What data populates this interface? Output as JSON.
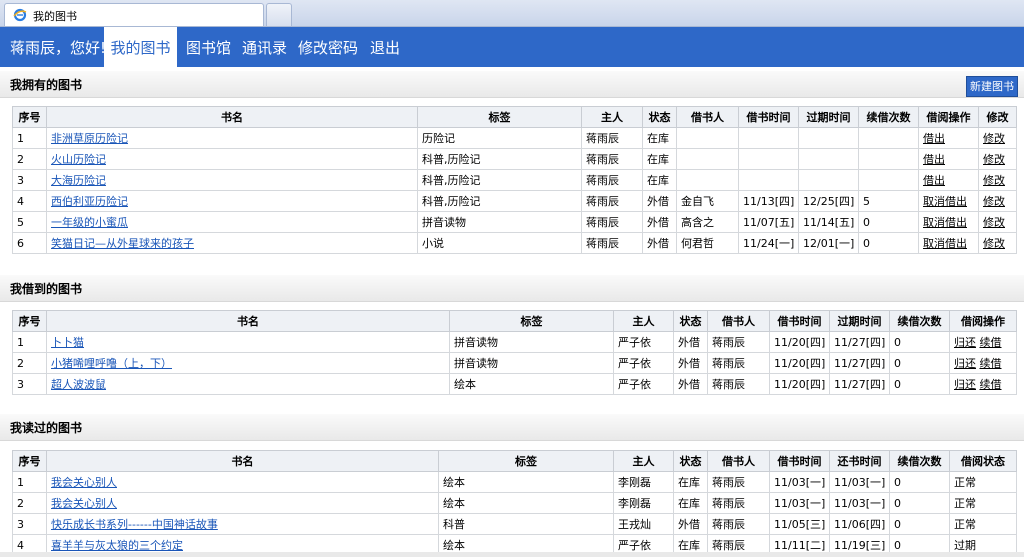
{
  "browser": {
    "tab_title": "我的图书"
  },
  "nav": {
    "greeting": "蒋雨辰，您好!",
    "items": [
      "我的图书",
      "图书馆",
      "通讯录",
      "修改密码",
      "退出"
    ]
  },
  "owned": {
    "title": "我拥有的图书",
    "new_button": "新建图书",
    "headers": [
      "序号",
      "书名",
      "标签",
      "主人",
      "状态",
      "借书人",
      "借书时间",
      "过期时间",
      "续借次数",
      "借阅操作",
      "修改"
    ],
    "rows": [
      {
        "no": "1",
        "name": "非洲草原历险记",
        "tag": "历险记",
        "owner": "蒋雨辰",
        "status": "在库",
        "borrower": "",
        "borrow_time": "",
        "due_time": "",
        "renew": "",
        "op": [
          "借出"
        ],
        "edit": "修改"
      },
      {
        "no": "2",
        "name": "火山历险记",
        "tag": "科普,历险记",
        "owner": "蒋雨辰",
        "status": "在库",
        "borrower": "",
        "borrow_time": "",
        "due_time": "",
        "renew": "",
        "op": [
          "借出"
        ],
        "edit": "修改"
      },
      {
        "no": "3",
        "name": "大海历险记",
        "tag": "科普,历险记",
        "owner": "蒋雨辰",
        "status": "在库",
        "borrower": "",
        "borrow_time": "",
        "due_time": "",
        "renew": "",
        "op": [
          "借出"
        ],
        "edit": "修改"
      },
      {
        "no": "4",
        "name": "西伯利亚历险记",
        "tag": "科普,历险记",
        "owner": "蒋雨辰",
        "status": "外借",
        "borrower": "金自飞",
        "borrow_time": "11/13[四]",
        "due_time": "12/25[四]",
        "renew": "5",
        "op": [
          "取消借出"
        ],
        "edit": "修改"
      },
      {
        "no": "5",
        "name": "一年级的小蜜瓜",
        "tag": "拼音读物",
        "owner": "蒋雨辰",
        "status": "外借",
        "borrower": "高含之",
        "borrow_time": "11/07[五]",
        "due_time": "11/14[五]",
        "renew": "0",
        "op": [
          "取消借出"
        ],
        "edit": "修改"
      },
      {
        "no": "6",
        "name": "笑猫日记—从外星球来的孩子",
        "tag": "小说",
        "owner": "蒋雨辰",
        "status": "外借",
        "borrower": "何君哲",
        "borrow_time": "11/24[一]",
        "due_time": "12/01[一]",
        "renew": "0",
        "op": [
          "取消借出"
        ],
        "edit": "修改"
      }
    ]
  },
  "borrowed": {
    "title": "我借到的图书",
    "headers": [
      "序号",
      "书名",
      "标签",
      "主人",
      "状态",
      "借书人",
      "借书时间",
      "过期时间",
      "续借次数",
      "借阅操作"
    ],
    "rows": [
      {
        "no": "1",
        "name": "卜卜猫",
        "tag": "拼音读物",
        "owner": "严子依",
        "status": "外借",
        "borrower": "蒋雨辰",
        "borrow_time": "11/20[四]",
        "due_time": "11/27[四]",
        "renew": "0",
        "op": [
          "归还",
          "续借"
        ]
      },
      {
        "no": "2",
        "name": "小猪唏哩呼噜（上，下）",
        "tag": "拼音读物",
        "owner": "严子依",
        "status": "外借",
        "borrower": "蒋雨辰",
        "borrow_time": "11/20[四]",
        "due_time": "11/27[四]",
        "renew": "0",
        "op": [
          "归还",
          "续借"
        ]
      },
      {
        "no": "3",
        "name": "超人波波鼠",
        "tag": "绘本",
        "owner": "严子依",
        "status": "外借",
        "borrower": "蒋雨辰",
        "borrow_time": "11/20[四]",
        "due_time": "11/27[四]",
        "renew": "0",
        "op": [
          "归还",
          "续借"
        ]
      }
    ]
  },
  "read": {
    "title": "我读过的图书",
    "headers": [
      "序号",
      "书名",
      "标签",
      "主人",
      "状态",
      "借书人",
      "借书时间",
      "还书时间",
      "续借次数",
      "借阅状态"
    ],
    "rows": [
      {
        "no": "1",
        "name": "我会关心别人",
        "tag": "绘本",
        "owner": "李刚磊",
        "status": "在库",
        "borrower": "蒋雨辰",
        "borrow_time": "11/03[一]",
        "return_time": "11/03[一]",
        "renew": "0",
        "state": "正常"
      },
      {
        "no": "2",
        "name": "我会关心别人",
        "tag": "绘本",
        "owner": "李刚磊",
        "status": "在库",
        "borrower": "蒋雨辰",
        "borrow_time": "11/03[一]",
        "return_time": "11/03[一]",
        "renew": "0",
        "state": "正常"
      },
      {
        "no": "3",
        "name": "快乐成长书系列------中国神话故事",
        "tag": "科普",
        "owner": "王戎灿",
        "status": "外借",
        "borrower": "蒋雨辰",
        "borrow_time": "11/05[三]",
        "return_time": "11/06[四]",
        "renew": "0",
        "state": "正常"
      },
      {
        "no": "4",
        "name": "喜羊羊与灰太狼的三个约定",
        "tag": "绘本",
        "owner": "严子依",
        "status": "在库",
        "borrower": "蒋雨辰",
        "borrow_time": "11/11[二]",
        "return_time": "11/19[三]",
        "renew": "0",
        "state": "过期"
      }
    ]
  },
  "colors": {
    "nav_bg": "#2e68c8",
    "link": "#1a56b8"
  }
}
